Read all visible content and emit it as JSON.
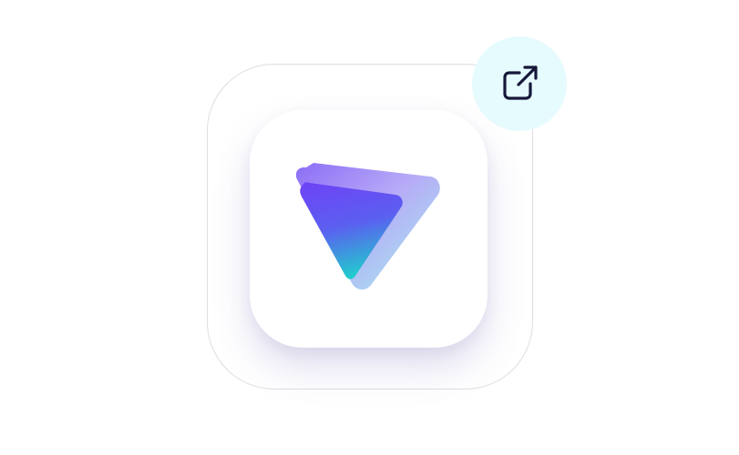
{
  "app_icon": {
    "logo_icon": "protonvpn-triangle-logo",
    "gradient_colors": {
      "purple": "#6f4df2",
      "lavender": "#b79cf5",
      "teal": "#23d6d0",
      "light_cyan": "#9ff0ee"
    },
    "tile_background": "#ffffff",
    "frame_border": "#dedee3"
  },
  "open_external": {
    "icon": "external-link-icon",
    "badge_background": "#e6fbfd",
    "icon_color": "#16183a"
  }
}
